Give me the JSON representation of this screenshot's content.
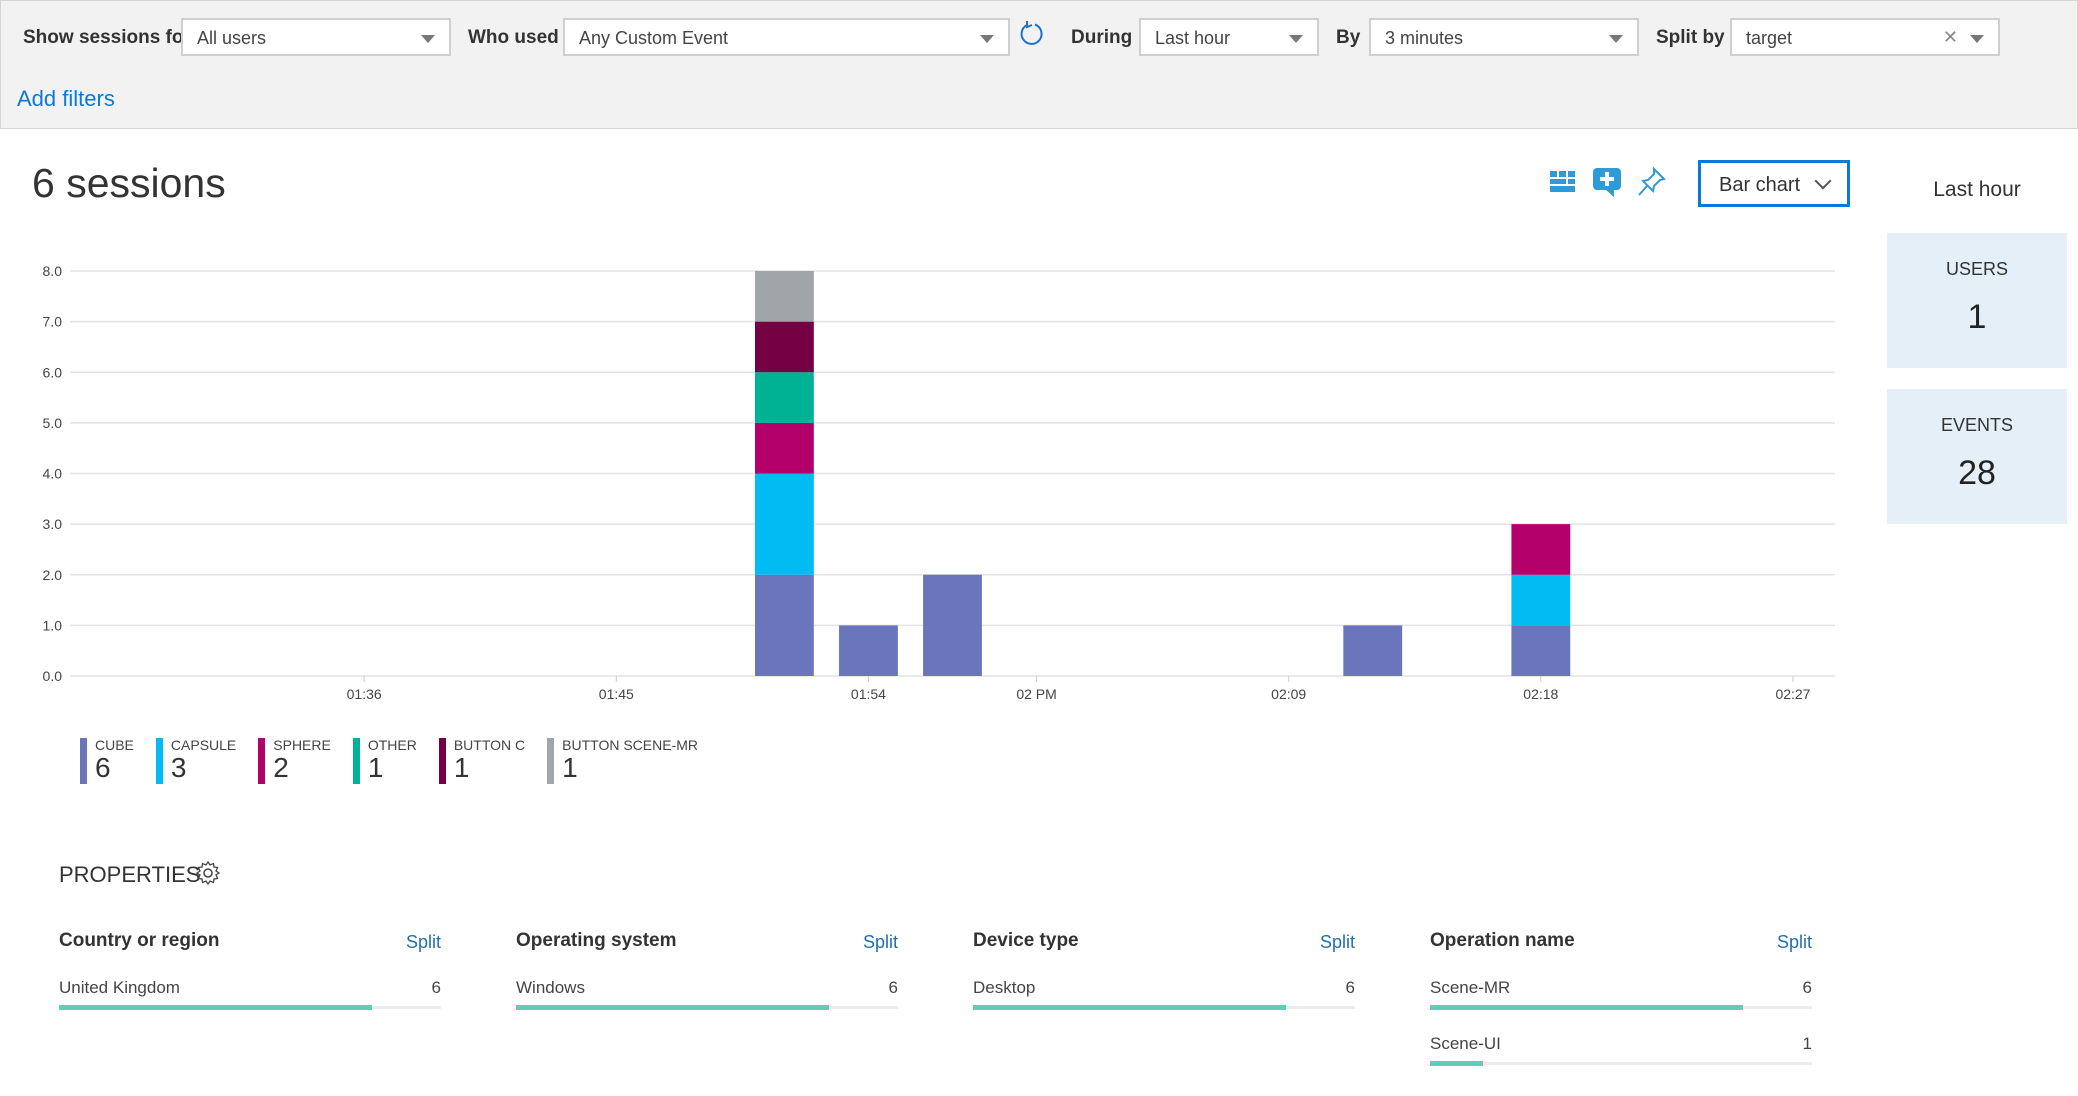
{
  "filters": {
    "show_sessions_label": "Show sessions for",
    "show_sessions_value": "All users",
    "who_used_label": "Who used",
    "who_used_value": "Any Custom Event",
    "during_label": "During",
    "during_value": "Last hour",
    "by_label": "By",
    "by_value": "3 minutes",
    "split_by_label": "Split by",
    "split_by_value": "target",
    "add_filters": "Add filters"
  },
  "header": {
    "title": "6 sessions",
    "chart_type": "Bar chart",
    "icons": [
      "grid-icon",
      "add-comment-icon",
      "pin-icon"
    ]
  },
  "summary": {
    "range_label": "Last hour",
    "users_label": "USERS",
    "users_value": "1",
    "events_label": "EVENTS",
    "events_value": "28"
  },
  "chart_data": {
    "type": "bar",
    "stacked": true,
    "title": "",
    "xlabel": "",
    "ylabel": "",
    "ylim": [
      0,
      8
    ],
    "yticks": [
      "0.0",
      "1.0",
      "2.0",
      "3.0",
      "4.0",
      "5.0",
      "6.0",
      "7.0",
      "8.0"
    ],
    "grid": true,
    "xticks": [
      {
        "label": "01:36",
        "minute": 96
      },
      {
        "label": "01:45",
        "minute": 105
      },
      {
        "label": "01:54",
        "minute": 114
      },
      {
        "label": "02 PM",
        "minute": 120
      },
      {
        "label": "02:09",
        "minute": 129
      },
      {
        "label": "02:18",
        "minute": 138
      },
      {
        "label": "02:27",
        "minute": 147
      }
    ],
    "xrange_minutes": [
      85.5,
      148.5
    ],
    "bin_minutes": 3,
    "categories": [
      "01:51",
      "01:54",
      "01:57",
      "02:12",
      "02:18"
    ],
    "category_minutes": [
      111,
      114,
      117,
      132,
      138
    ],
    "series": [
      {
        "name": "CUBE",
        "color": "#6a75bb",
        "values": [
          2,
          1,
          2,
          1,
          1
        ]
      },
      {
        "name": "CAPSULE",
        "color": "#00bcf2",
        "values": [
          2,
          0,
          0,
          0,
          1
        ]
      },
      {
        "name": "SPHERE",
        "color": "#b4006a",
        "values": [
          1,
          0,
          0,
          0,
          1
        ]
      },
      {
        "name": "OTHER",
        "color": "#00b294",
        "values": [
          1,
          0,
          0,
          0,
          0
        ]
      },
      {
        "name": "BUTTON C",
        "color": "#750042",
        "values": [
          1,
          0,
          0,
          0,
          0
        ]
      },
      {
        "name": "BUTTON SCENE-MR",
        "color": "#a0a5a8",
        "values": [
          1,
          0,
          0,
          0,
          0
        ]
      }
    ],
    "legend": [
      {
        "name": "CUBE",
        "count": "6",
        "color": "#6a75bb"
      },
      {
        "name": "CAPSULE",
        "count": "3",
        "color": "#00bcf2"
      },
      {
        "name": "SPHERE",
        "count": "2",
        "color": "#b4006a"
      },
      {
        "name": "OTHER",
        "count": "1",
        "color": "#00b294"
      },
      {
        "name": "BUTTON C",
        "count": "1",
        "color": "#750042"
      },
      {
        "name": "BUTTON SCENE-MR",
        "count": "1",
        "color": "#a0a5a8"
      }
    ],
    "legend_position": "bottom-left"
  },
  "properties": {
    "title": "PROPERTIES",
    "split_label": "Split",
    "columns": [
      {
        "name": "Country or region",
        "rows": [
          {
            "label": "United Kingdom",
            "value": "6",
            "fraction": 0.82
          }
        ]
      },
      {
        "name": "Operating system",
        "rows": [
          {
            "label": "Windows",
            "value": "6",
            "fraction": 0.82
          }
        ]
      },
      {
        "name": "Device type",
        "rows": [
          {
            "label": "Desktop",
            "value": "6",
            "fraction": 0.82
          }
        ]
      },
      {
        "name": "Operation name",
        "rows": [
          {
            "label": "Scene-MR",
            "value": "6",
            "fraction": 0.82
          },
          {
            "label": "Scene-UI",
            "value": "1",
            "fraction": 0.14
          }
        ]
      }
    ]
  }
}
